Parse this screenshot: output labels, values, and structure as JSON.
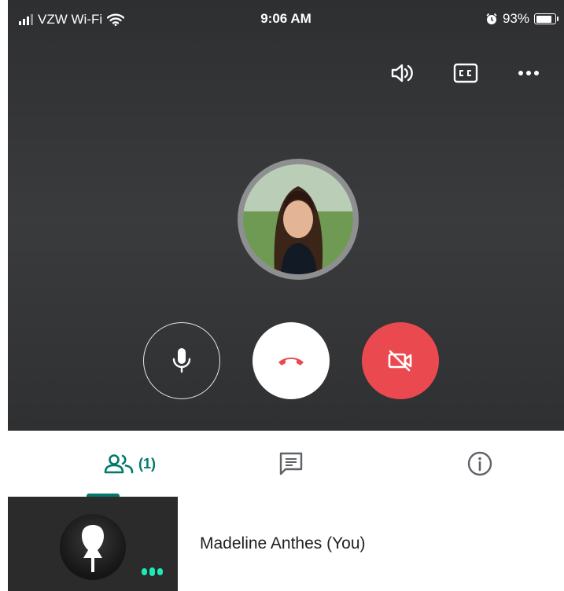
{
  "status_bar": {
    "carrier": "VZW Wi-Fi",
    "time": "9:06 AM",
    "battery_percent": "93%",
    "battery_level": 0.93
  },
  "call": {
    "top_icons": [
      "speaker-icon",
      "closed-captions-icon",
      "more-options-icon"
    ],
    "controls": {
      "mic_icon": "microphone-icon",
      "hangup_icon": "phone-hangup-icon",
      "camera_icon": "camera-off-icon",
      "camera_off_color": "#ea4a4f",
      "hangup_icon_color": "#ea4a4f"
    }
  },
  "tabs": {
    "people_count": "(1)",
    "active_color": "#00796b",
    "items": [
      "people-icon",
      "chat-icon",
      "info-icon"
    ]
  },
  "participants": [
    {
      "name": "Madeline Anthes (You)",
      "speaking": true
    }
  ]
}
